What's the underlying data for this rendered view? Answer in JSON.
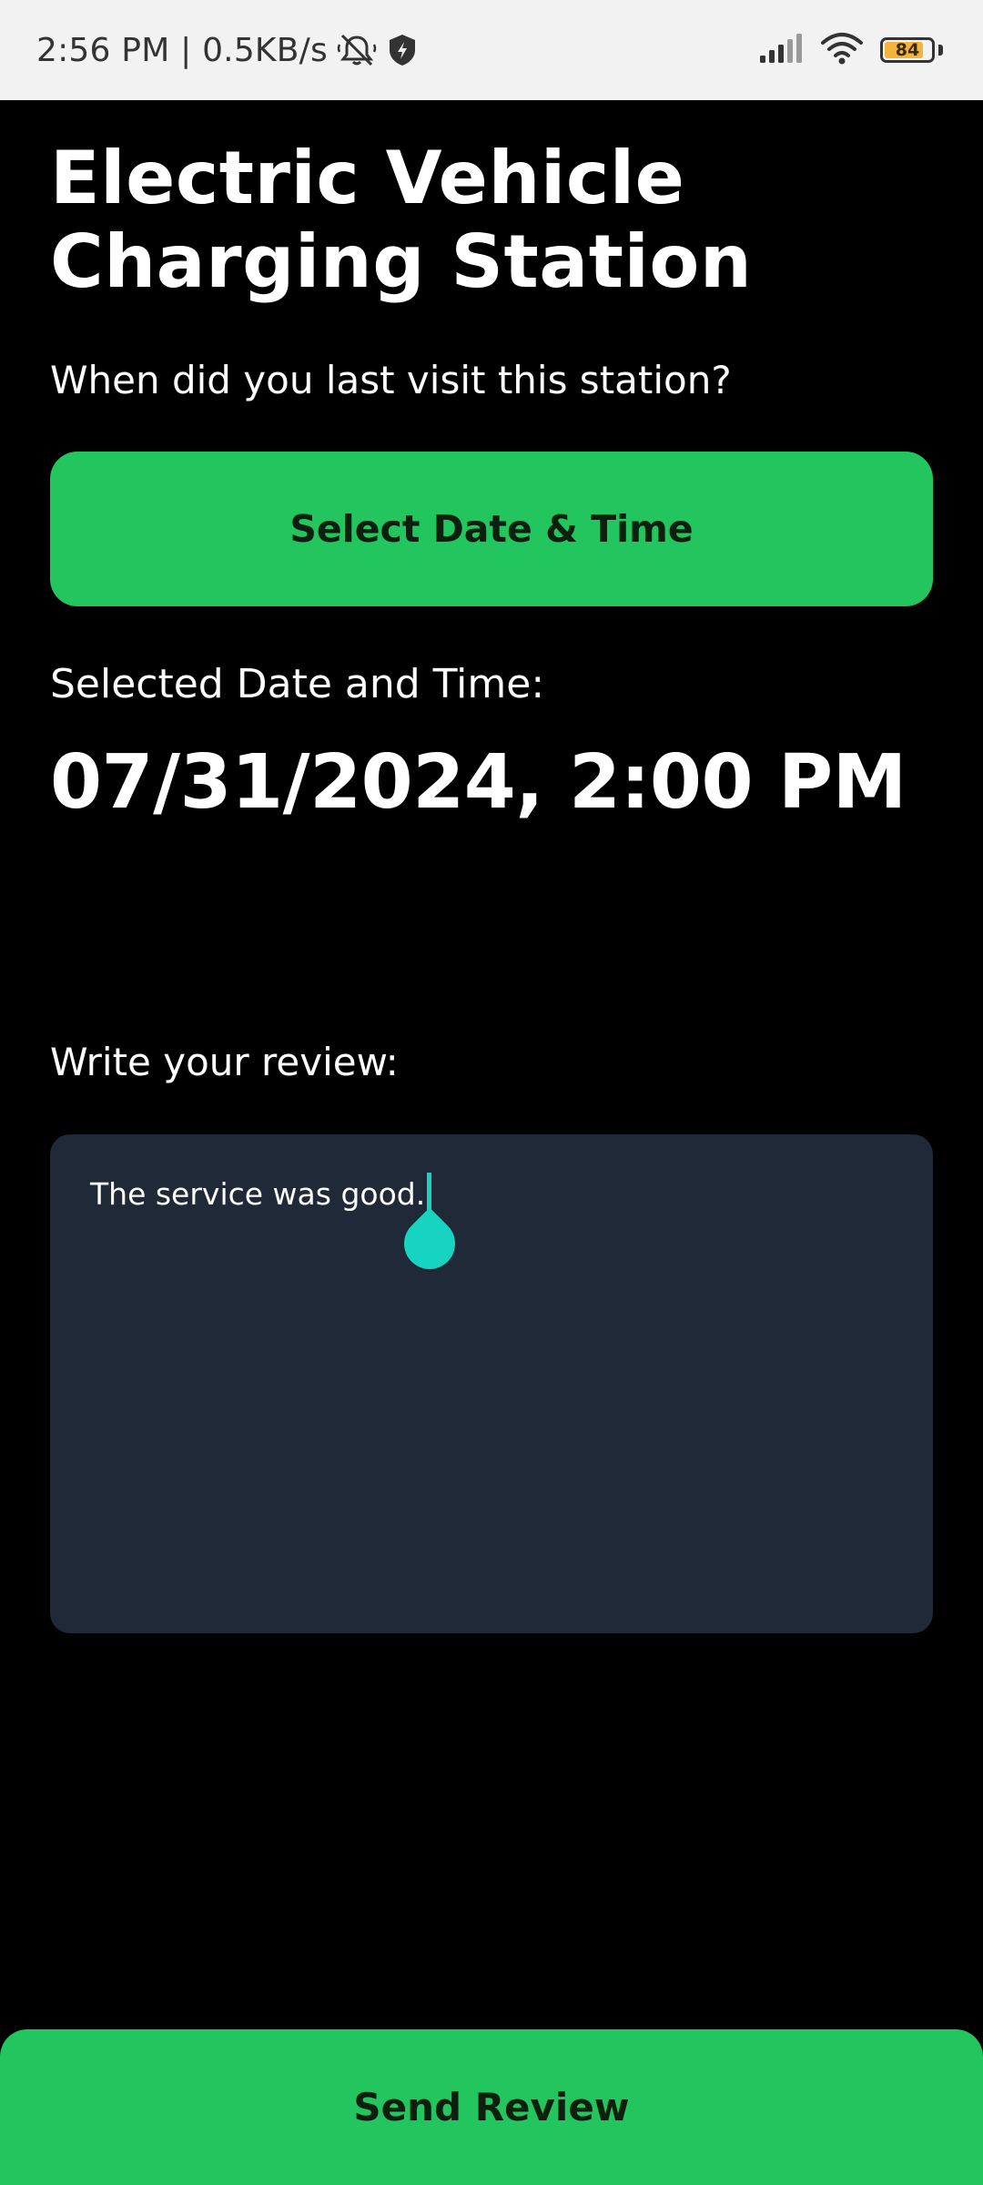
{
  "status_bar": {
    "time_speed": "2:56 PM | 0.5KB/s",
    "battery_level": "84",
    "battery_fraction": 0.84,
    "battery_color": "#f3b33d",
    "icons": [
      "mute-icon",
      "shield-icon",
      "signal-icon",
      "wifi-icon",
      "battery-icon"
    ]
  },
  "header": {
    "title": "Electric Vehicle Charging Station"
  },
  "visit": {
    "question": "When did you last visit this station?",
    "select_button_label": "Select Date & Time",
    "selected_label": "Selected Date and Time:",
    "selected_value": "07/31/2024, 2:00 PM"
  },
  "review": {
    "label": "Write your review:",
    "text": "The service was good."
  },
  "footer": {
    "send_button_label": "Send Review"
  },
  "colors": {
    "accent": "#22c55e",
    "background": "#000000",
    "input_background": "#1f2937",
    "cursor": "#17d4c0"
  }
}
